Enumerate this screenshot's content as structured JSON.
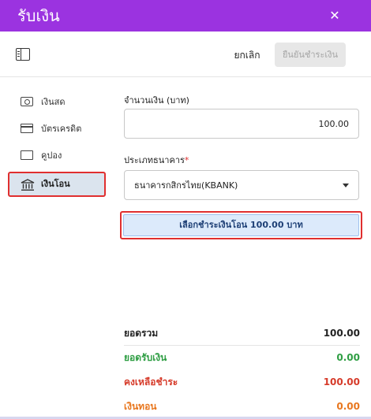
{
  "header": {
    "title": "รับเงิน",
    "close_glyph": "✕",
    "bg_color": "#9b33e0"
  },
  "toolbar": {
    "cancel_label": "ยกเลิก",
    "confirm_label": "ยืนยันชำระเงิน"
  },
  "sidebar": {
    "items": [
      {
        "label": "เงินสด",
        "icon": "cash-icon"
      },
      {
        "label": "บัตรเครดิต",
        "icon": "credit-card-icon"
      },
      {
        "label": "คูปอง",
        "icon": "coupon-icon"
      },
      {
        "label": "เงินโอน",
        "icon": "bank-icon",
        "active": true
      }
    ]
  },
  "form": {
    "amount_label": "จำนวนเงิน (บาท)",
    "amount_value": "100.00",
    "bank_label": "ประเภทธนาคาร",
    "required_mark": "*",
    "bank_value": "ธนาคารกสิกรไทย(KBANK)",
    "transfer_button": "เลือกชำระเงินโอน 100.00 บาท"
  },
  "summary": {
    "total_label": "ยอดรวม",
    "total_value": "100.00",
    "received_label": "ยอดรับเงิน",
    "received_value": "0.00",
    "remaining_label": "คงเหลือชำระ",
    "remaining_value": "100.00",
    "change_label": "เงินทอน",
    "change_value": "0.00"
  },
  "colors": {
    "accent": "#9b33e0",
    "green": "#2f9e44",
    "red": "#d63b2a",
    "orange": "#e8771f",
    "highlight": "#e02f2f"
  }
}
